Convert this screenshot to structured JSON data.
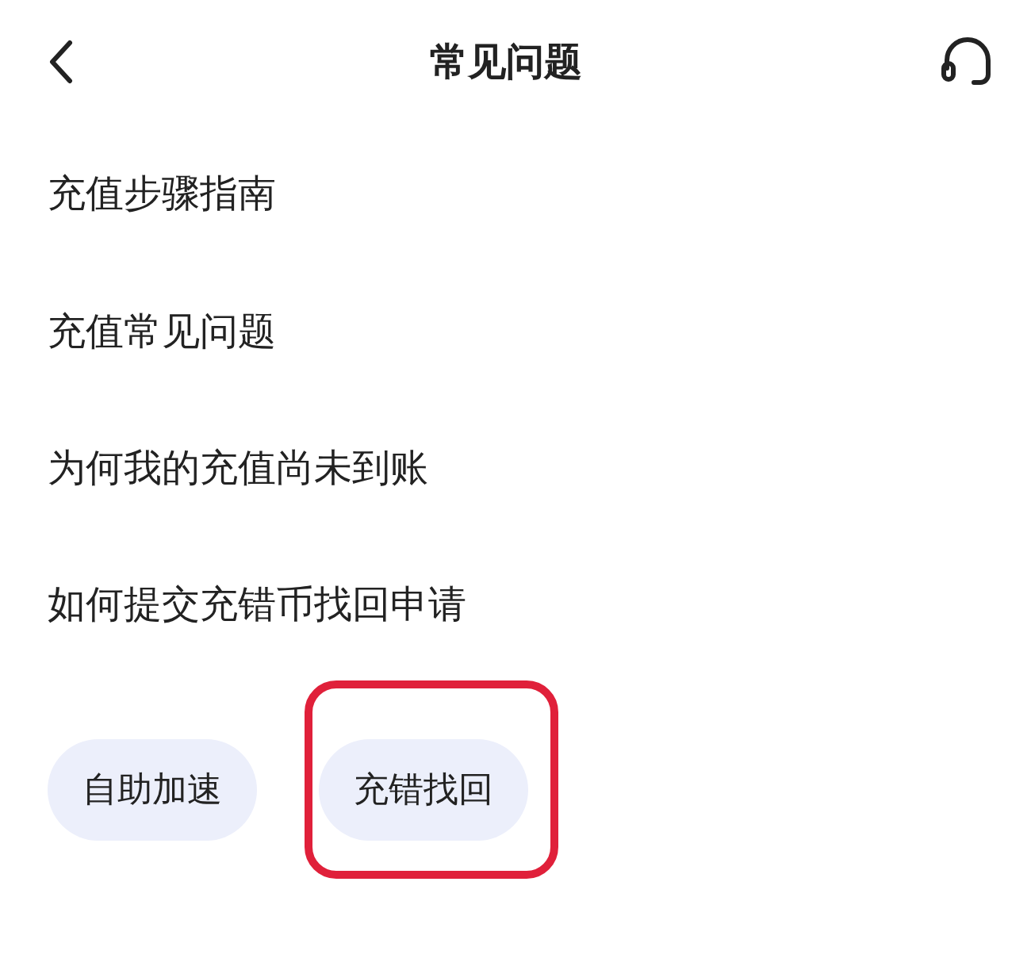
{
  "header": {
    "title": "常见问题"
  },
  "items": [
    {
      "label": "充值步骤指南"
    },
    {
      "label": "充值常见问题"
    },
    {
      "label": "为何我的充值尚未到账"
    },
    {
      "label": "如何提交充错币找回申请"
    }
  ],
  "buttons": [
    {
      "label": "自助加速",
      "highlighted": false
    },
    {
      "label": "充错找回",
      "highlighted": true
    }
  ]
}
